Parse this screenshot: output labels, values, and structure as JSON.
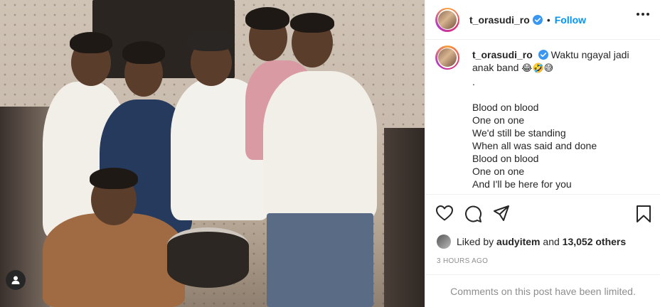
{
  "post": {
    "username": "t_orasudi_ro",
    "follow_label": "Follow",
    "separator": "•",
    "caption": {
      "username": "t_orasudi_ro",
      "text": "Waktu ngayal jadi anak band",
      "emojis": "😂🤣😅",
      "dot": ".",
      "lyrics": [
        "Blood on blood",
        "One on one",
        "We'd still be standing",
        "When all was said and done",
        "Blood on blood",
        "One on one",
        "And I'll be here for you"
      ]
    },
    "likes": {
      "prefix": "Liked by",
      "user": "audyitem",
      "joiner": "and",
      "others": "13,052 others"
    },
    "timestamp": "3 HOURS AGO",
    "comments_limited": "Comments on this post have been limited."
  },
  "icons": {
    "verified": "verified-badge-icon",
    "more": "more-options-icon",
    "like": "heart-icon",
    "comment": "comment-icon",
    "share": "paper-plane-icon",
    "save": "bookmark-icon",
    "user_tag": "user-tag-icon"
  },
  "colors": {
    "follow_blue": "#0095f6",
    "verified_blue": "#3897f0",
    "text_primary": "#262626",
    "text_secondary": "#8e8e8e",
    "border": "#efefef"
  }
}
